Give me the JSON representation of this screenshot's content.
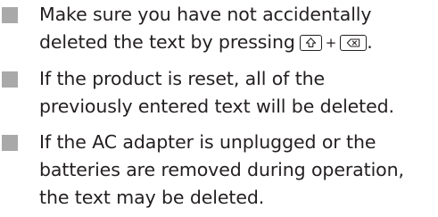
{
  "notes": [
    {
      "lines": [
        "Make sure you have not accidentally",
        "deleted the text by pressing"
      ],
      "keys": {
        "first": "shift-key-icon",
        "joiner": "+",
        "second": "backspace-key-icon",
        "after": "."
      }
    },
    {
      "lines": [
        "If the product is reset, all of the",
        "previously entered text will be deleted."
      ]
    },
    {
      "lines": [
        "If the AC adapter is unplugged or the",
        "batteries are removed during operation,",
        "the text may be deleted."
      ]
    }
  ],
  "colors": {
    "bullet": "#a9a9a9",
    "text": "#231f20"
  }
}
